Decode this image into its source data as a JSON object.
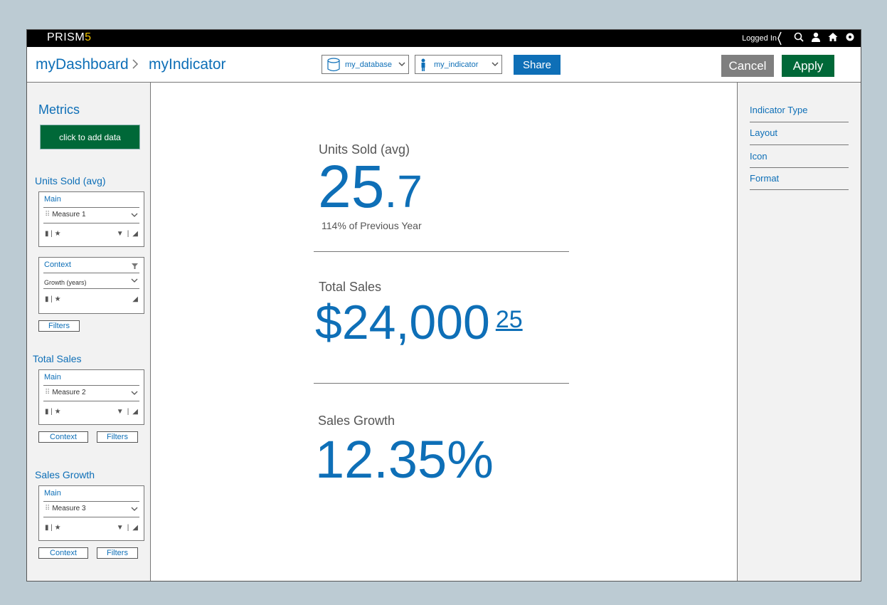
{
  "app": {
    "logo_main": "PRISM",
    "logo_version": "5",
    "status": "Logged In"
  },
  "topbar_icons": [
    "search-icon",
    "user-icon",
    "home-icon",
    "settings-icon"
  ],
  "breadcrumb": {
    "root": "myDashboard",
    "current": "myIndicator"
  },
  "selectors": {
    "database": "my_database",
    "indicator": "my_indicator"
  },
  "actions": {
    "share": "Share",
    "cancel": "Cancel",
    "apply": "Apply"
  },
  "left_panel": {
    "title": "Metrics",
    "add_data": "click to add data",
    "sections": [
      {
        "title": "Units Sold (avg)",
        "main": {
          "header": "Main",
          "measure": "Measure 1"
        },
        "context": {
          "header": "Context",
          "measure": "Growth (years)"
        },
        "buttons": [
          "Filters"
        ]
      },
      {
        "title": "Total Sales",
        "main": {
          "header": "Main",
          "measure": "Measure 2"
        },
        "buttons": [
          "Context",
          "Filters"
        ]
      },
      {
        "title": "Sales Growth",
        "main": {
          "header": "Main",
          "measure": "Measure 3"
        },
        "buttons": [
          "Context",
          "Filters"
        ]
      }
    ]
  },
  "indicators": [
    {
      "label": "Units Sold (avg)",
      "value_int": "25",
      "value_dec": ".7",
      "sub": "114% of Previous Year"
    },
    {
      "label": "Total Sales",
      "value_int": "$24,000",
      "value_sup": "25"
    },
    {
      "label": "Sales Growth",
      "value": "12.35%"
    }
  ],
  "right_panel": {
    "items": [
      "Indicator Type",
      "Layout",
      "Icon",
      "Format"
    ]
  },
  "colors": {
    "accent": "#0e6fb7",
    "apply": "#006838",
    "cancel": "#7f7f7f",
    "background": "#bccbd3"
  }
}
